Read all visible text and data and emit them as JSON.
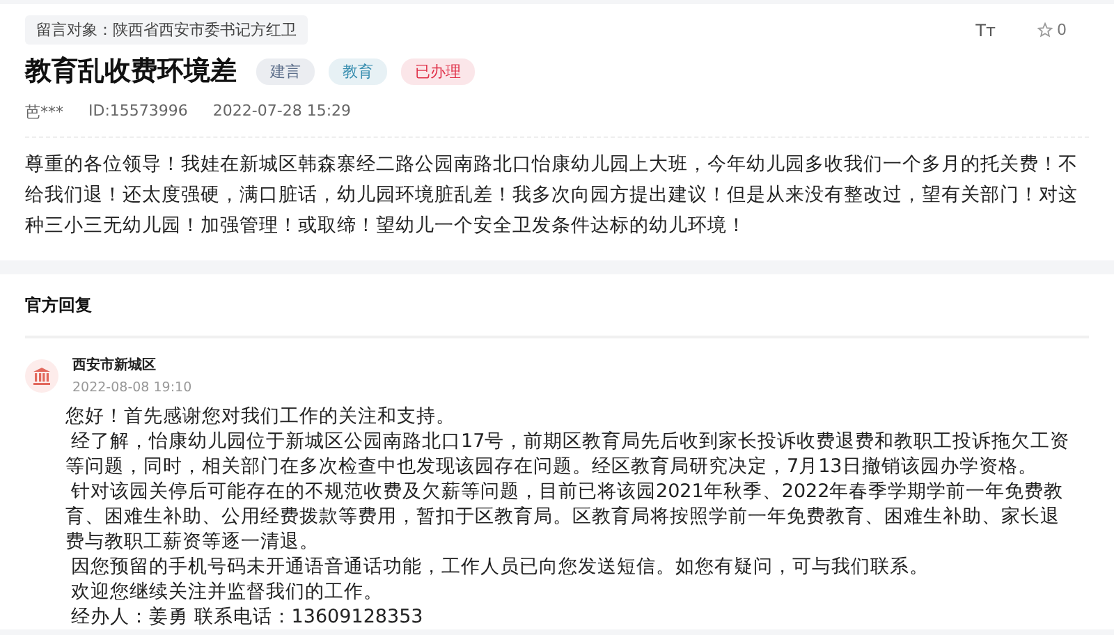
{
  "header": {
    "target": "留言对象：陕西省西安市委书记方红卫",
    "font_button": "Tт",
    "likes": "0"
  },
  "title": "教育乱收费环境差",
  "tags": [
    {
      "label": "建言",
      "color": "#5c6e8a"
    },
    {
      "label": "教育",
      "color": "#3a8fb0"
    },
    {
      "label": "已办理",
      "color": "#e0324a"
    }
  ],
  "meta": {
    "author": "芭***",
    "id": "ID:15573996",
    "time": "2022-07-28 15:29"
  },
  "message": "尊重的各位领导！我娃在新城区韩森寨经二路公园南路北口怡康幼儿园上大班，今年幼儿园多收我们一个多月的托关费！不给我们退！还太度强硬，满口脏话，幼儿园环境脏乱差！我多次向园方提出建议！但是从来没有整改过，望有关部门！对这种三小三无幼儿园！加强管理！或取缔！望幼儿一个安全卫发条件达标的幼儿环境！",
  "reply_section": {
    "heading": "官方回复",
    "org": "西安市新城区",
    "time": "2022-08-08 19:10",
    "paragraphs": [
      "您好！首先感谢您对我们工作的关注和支持。",
      "经了解，怡康幼儿园位于新城区公园南路北口17号，前期区教育局先后收到家长投诉收费退费和教职工投诉拖欠工资等问题，同时，相关部门在多次检查中也发现该园存在问题。经区教育局研究决定，7月13日撤销该园办学资格。",
      "针对该园关停后可能存在的不规范收费及欠薪等问题，目前已将该园2021年秋季、2022年春季学期学前一年免费教育、困难生补助、公用经费拨款等费用，暂扣于区教育局。区教育局将按照学前一年免费教育、困难生补助、家长退费与教职工薪资等逐一清退。",
      "因您预留的手机号码未开通语音通话功能，工作人员已向您发送短信。如您有疑问，可与我们联系。",
      "欢迎您继续关注并监督我们的工作。",
      "经办人：姜勇 联系电话：13609128353"
    ]
  }
}
